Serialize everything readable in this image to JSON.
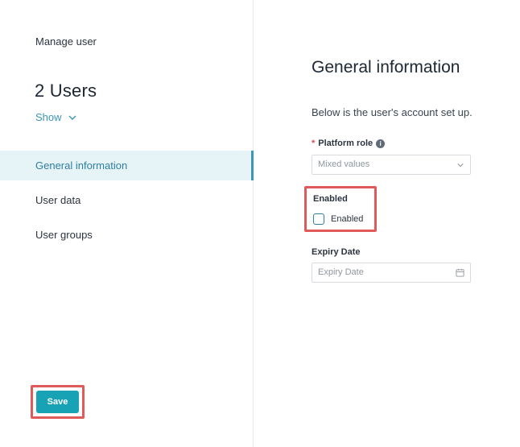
{
  "sidebar": {
    "header": "Manage user",
    "users_title": "2 Users",
    "show_label": "Show",
    "nav_items": [
      {
        "label": "General information",
        "active": true
      },
      {
        "label": "User data",
        "active": false
      },
      {
        "label": "User groups",
        "active": false
      }
    ],
    "save_label": "Save"
  },
  "main": {
    "title": "General information",
    "description": "Below is the user's account set up.",
    "platform_role": {
      "required_mark": "*",
      "label": "Platform role",
      "value": "Mixed values"
    },
    "enabled": {
      "section_label": "Enabled",
      "checkbox_label": "Enabled",
      "checked": false
    },
    "expiry": {
      "label": "Expiry Date",
      "placeholder": "Expiry Date"
    }
  },
  "colors": {
    "accent": "#17a3b5",
    "link": "#3a97b8",
    "active_bg": "#e6f4f7",
    "highlight_border": "#e05a5a",
    "required": "#e04747"
  },
  "icons": {
    "show": "chevron-down-icon",
    "platform_role_info": "info-icon",
    "select": "chevron-down-icon",
    "expiry": "calendar-icon"
  }
}
